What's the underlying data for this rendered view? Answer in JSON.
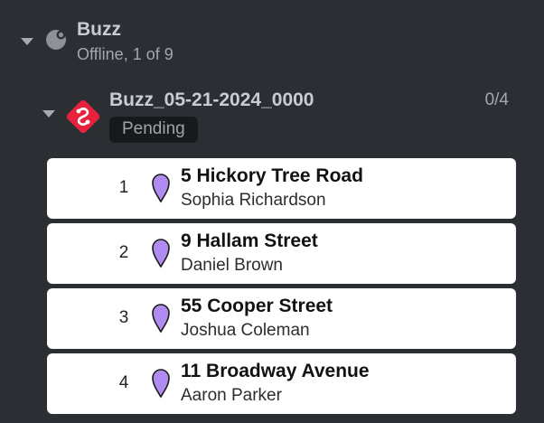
{
  "colors": {
    "panel_bg": "#2b2e33",
    "card_bg": "#ffffff",
    "pin_fill": "#b08cf0",
    "route_icon": "#e8213c",
    "badge_bg": "#17191c"
  },
  "driver": {
    "name": "Buzz",
    "status": "Offline, 1 of 9",
    "icon": "offline-status-icon"
  },
  "route": {
    "name": "Buzz_05-21-2024_0000",
    "progress": "0/4",
    "status": "Pending",
    "icon": "route-icon"
  },
  "stops": [
    {
      "number": "1",
      "address": "5 Hickory Tree Road",
      "customer": "Sophia Richardson"
    },
    {
      "number": "2",
      "address": "9 Hallam Street",
      "customer": "Daniel Brown"
    },
    {
      "number": "3",
      "address": "55 Cooper Street",
      "customer": "Joshua Coleman"
    },
    {
      "number": "4",
      "address": "11 Broadway Avenue",
      "customer": "Aaron Parker"
    }
  ]
}
